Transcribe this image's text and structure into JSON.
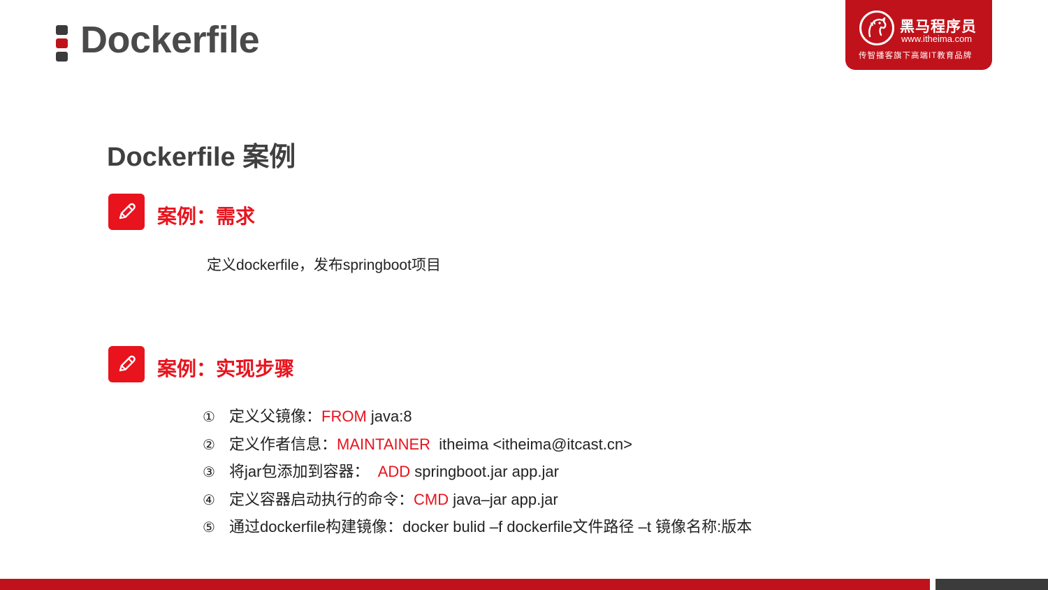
{
  "slide": {
    "title": "Dockerfile",
    "section_heading": "Dockerfile 案例"
  },
  "logo": {
    "name": "黑马程序员",
    "url": "www.itheima.com",
    "slogan": "传智播客旗下高端IT教育品牌",
    "icon": "horse-head-icon"
  },
  "requirement": {
    "title": "案例：需求",
    "icon": "pencil-icon",
    "text": "定义dockerfile，发布springboot项目"
  },
  "implementation": {
    "title": "案例：实现步骤",
    "icon": "pencil-icon",
    "steps": [
      {
        "num": "①",
        "label": "定义父镜像：",
        "keyword": "FROM",
        "rest": " java:8"
      },
      {
        "num": "②",
        "label": "定义作者信息：",
        "keyword": "MAINTAINER",
        "rest": "  itheima <itheima@itcast.cn>"
      },
      {
        "num": "③",
        "label": "将jar包添加到容器：  ",
        "keyword": "ADD",
        "rest": " springboot.jar app.jar"
      },
      {
        "num": "④",
        "label": "定义容器启动执行的命令：",
        "keyword": "CMD",
        "rest": " java–jar app.jar"
      },
      {
        "num": "⑤",
        "label": "通过dockerfile构建镜像：docker bulid –f dockerfile文件路径 –t 镜像名称:版本",
        "keyword": "",
        "rest": ""
      }
    ]
  },
  "colors": {
    "accent_red": "#e8131d",
    "brand_red": "#c0121b",
    "dark_gray": "#3b3b3b"
  }
}
